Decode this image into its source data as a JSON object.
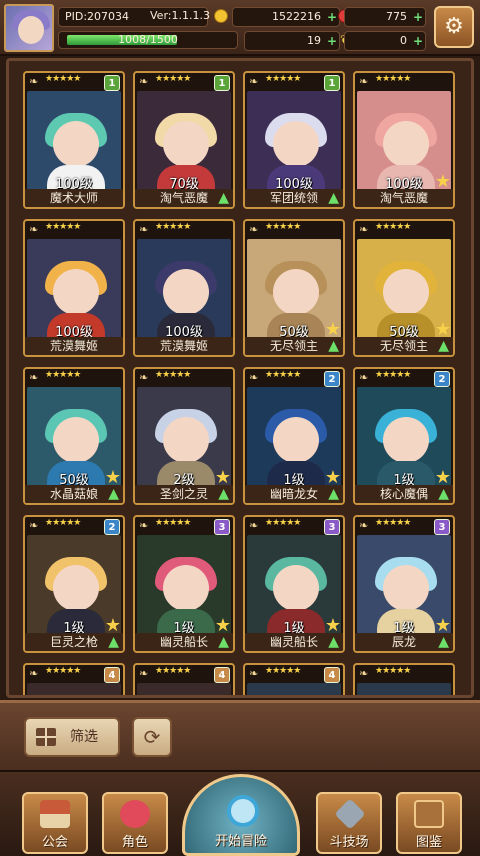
{
  "header": {
    "pid_label": "PID:207034",
    "version": "Ver:1.1.1.3",
    "gold": "1522216",
    "gems": "775",
    "xp_text": "1008/1500",
    "xp_progress": 0.672,
    "clovers": "19",
    "leaves": "0"
  },
  "cards": [
    {
      "level": "100级",
      "name": "魔术大师",
      "badge": "1",
      "badge_color": "#5aa43a",
      "hair": "#5cc9b0",
      "bg": "#2d4a6a",
      "body": "#f2f2f2",
      "star": false,
      "up": false
    },
    {
      "level": "70级",
      "name": "淘气恶魔",
      "badge": "1",
      "badge_color": "#5aa43a",
      "hair": "#f2d9a8",
      "bg": "#3a2a3a",
      "body": "#c43a3a",
      "star": false,
      "up": true
    },
    {
      "level": "100级",
      "name": "军团统领",
      "badge": "1",
      "badge_color": "#5aa43a",
      "hair": "#dcdcef",
      "bg": "#3d2e55",
      "body": "#4a3a7a",
      "star": false,
      "up": true
    },
    {
      "level": "100级",
      "name": "淘气恶魔",
      "badge": "",
      "badge_color": "",
      "hair": "#f0a6a0",
      "bg": "#d58e8c",
      "body": "#e8b7b0",
      "star": true,
      "up": false
    },
    {
      "level": "100级",
      "name": "荒漠舞姬",
      "badge": "",
      "badge_color": "",
      "hair": "#f1b24a",
      "bg": "#3a3a5a",
      "body": "#c43a2a",
      "star": false,
      "up": false
    },
    {
      "level": "100级",
      "name": "荒漠舞姬",
      "badge": "",
      "badge_color": "",
      "hair": "#3b3a6a",
      "bg": "#2a3a5a",
      "body": "#2a2a3a",
      "star": false,
      "up": false
    },
    {
      "level": "50级",
      "name": "无尽领主",
      "badge": "",
      "badge_color": "",
      "hair": "#b8915a",
      "bg": "#c8a878",
      "body": "#a88456",
      "star": true,
      "up": true
    },
    {
      "level": "50级",
      "name": "无尽领主",
      "badge": "",
      "badge_color": "",
      "hair": "#e2b33a",
      "bg": "#d8b04a",
      "body": "#b8902a",
      "star": true,
      "up": true
    },
    {
      "level": "50级",
      "name": "水晶菇娘",
      "badge": "",
      "badge_color": "",
      "hair": "#5cc6b4",
      "bg": "#2d5a6a",
      "body": "#2d7ab0",
      "star": true,
      "up": true
    },
    {
      "level": "2级",
      "name": "圣剑之灵",
      "badge": "",
      "badge_color": "",
      "hair": "#c8d2e6",
      "bg": "#3a3a4a",
      "body": "#9a8a6a",
      "star": true,
      "up": true
    },
    {
      "level": "1级",
      "name": "幽暗龙女",
      "badge": "2",
      "badge_color": "#3a86c8",
      "hair": "#2a5aa8",
      "bg": "#1e3a5a",
      "body": "#1e2a4a",
      "star": true,
      "up": true
    },
    {
      "level": "1级",
      "name": "核心魔偶",
      "badge": "2",
      "badge_color": "#3a86c8",
      "hair": "#3ab2d8",
      "bg": "#1e4a5a",
      "body": "#2a5a6a",
      "star": true,
      "up": true
    },
    {
      "level": "1级",
      "name": "巨灵之枪",
      "badge": "2",
      "badge_color": "#3a86c8",
      "hair": "#f0c26a",
      "bg": "#4a3a2a",
      "body": "#2a2a3a",
      "star": true,
      "up": true
    },
    {
      "level": "1级",
      "name": "幽灵船长",
      "badge": "3",
      "badge_color": "#8a5ac8",
      "hair": "#e05a7a",
      "bg": "#2a3a2a",
      "body": "#3a6a4a",
      "star": true,
      "up": true
    },
    {
      "level": "1级",
      "name": "幽灵船长",
      "badge": "3",
      "badge_color": "#8a5ac8",
      "hair": "#5ab8a0",
      "bg": "#2a3a3a",
      "body": "#8a2a2a",
      "star": true,
      "up": true
    },
    {
      "level": "1级",
      "name": "辰龙",
      "badge": "3",
      "badge_color": "#8a5ac8",
      "hair": "#a8dcef",
      "bg": "#3a4a6a",
      "body": "#e6d2a0",
      "star": true,
      "up": true
    },
    {
      "level": "",
      "name": "",
      "badge": "4",
      "badge_color": "#c88a48",
      "hair": "#f3e3d3",
      "bg": "#3a2a2a",
      "body": "#3a2a2a",
      "star": false,
      "up": false
    },
    {
      "level": "",
      "name": "",
      "badge": "4",
      "badge_color": "#c88a48",
      "hair": "#f3e0c0",
      "bg": "#3a2a2a",
      "body": "#3a2a2a",
      "star": false,
      "up": false
    },
    {
      "level": "",
      "name": "",
      "badge": "4",
      "badge_color": "#c88a48",
      "hair": "#5ad0e0",
      "bg": "#2a3a4a",
      "body": "#2a3a4a",
      "star": false,
      "up": false
    },
    {
      "level": "",
      "name": "",
      "badge": "",
      "badge_color": "",
      "hair": "#5ad0e0",
      "bg": "#2a3a4a",
      "body": "#2a3a4a",
      "star": false,
      "up": false
    }
  ],
  "toolbar": {
    "filter_label": "筛选",
    "refresh_icon": "refresh-icon"
  },
  "nav": {
    "guild": "公会",
    "character": "角色",
    "adventure": "开始冒险",
    "arena": "斗技场",
    "codex": "图鉴"
  }
}
